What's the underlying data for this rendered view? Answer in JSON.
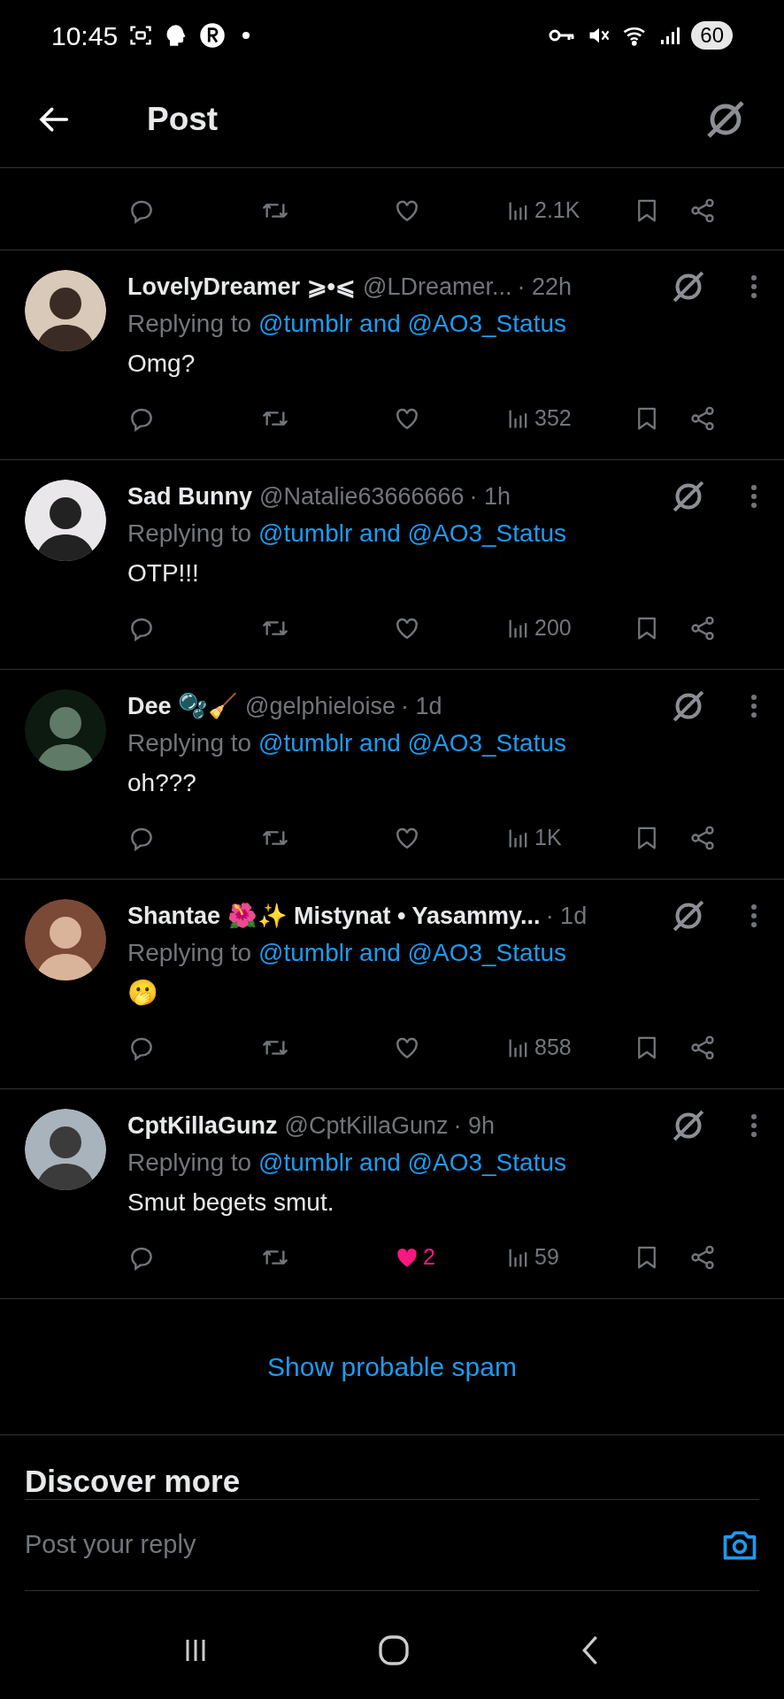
{
  "status_bar": {
    "time": "10:45",
    "battery": "60"
  },
  "header": {
    "title": "Post"
  },
  "top_post_actions": {
    "views": "2.1K"
  },
  "replies": [
    {
      "display_name": "LovelyDreamer ⩾•⩽",
      "handle": "@LDreamer...",
      "time": "· 22h",
      "replying_prefix": "Replying to",
      "replying_to": "@tumblr and @AO3_Status",
      "text": "Omg?",
      "liked": false,
      "views": "352"
    },
    {
      "display_name": "Sad Bunny",
      "handle": "@Natalie63666666",
      "time": "· 1h",
      "replying_prefix": "Replying to",
      "replying_to": "@tumblr and @AO3_Status",
      "text": "OTP!!!",
      "liked": false,
      "views": "200"
    },
    {
      "display_name": "Dee 🫧🧹",
      "handle": "@gelphieloise",
      "time": "· 1d",
      "replying_prefix": "Replying to",
      "replying_to": "@tumblr and @AO3_Status",
      "text": "oh???",
      "liked": false,
      "views": "1K"
    },
    {
      "display_name": "Shantae 🌺✨ Mistynat • Yasammy...",
      "time": "· 1d",
      "replying_prefix": "Replying to",
      "replying_to": "@tumblr and @AO3_Status",
      "text": "🫢",
      "liked": false,
      "views": "858"
    },
    {
      "display_name": "CptKillaGunz",
      "handle": "@CptKillaGunz",
      "time": "· 9h",
      "replying_prefix": "Replying to",
      "replying_to": "@tumblr and @AO3_Status",
      "text": "Smut begets smut.",
      "liked": true,
      "likes": "2",
      "views": "59"
    }
  ],
  "spam_link": "Show probable spam",
  "discover": {
    "title": "Discover more"
  },
  "reply_bar": {
    "placeholder": "Post your reply"
  }
}
